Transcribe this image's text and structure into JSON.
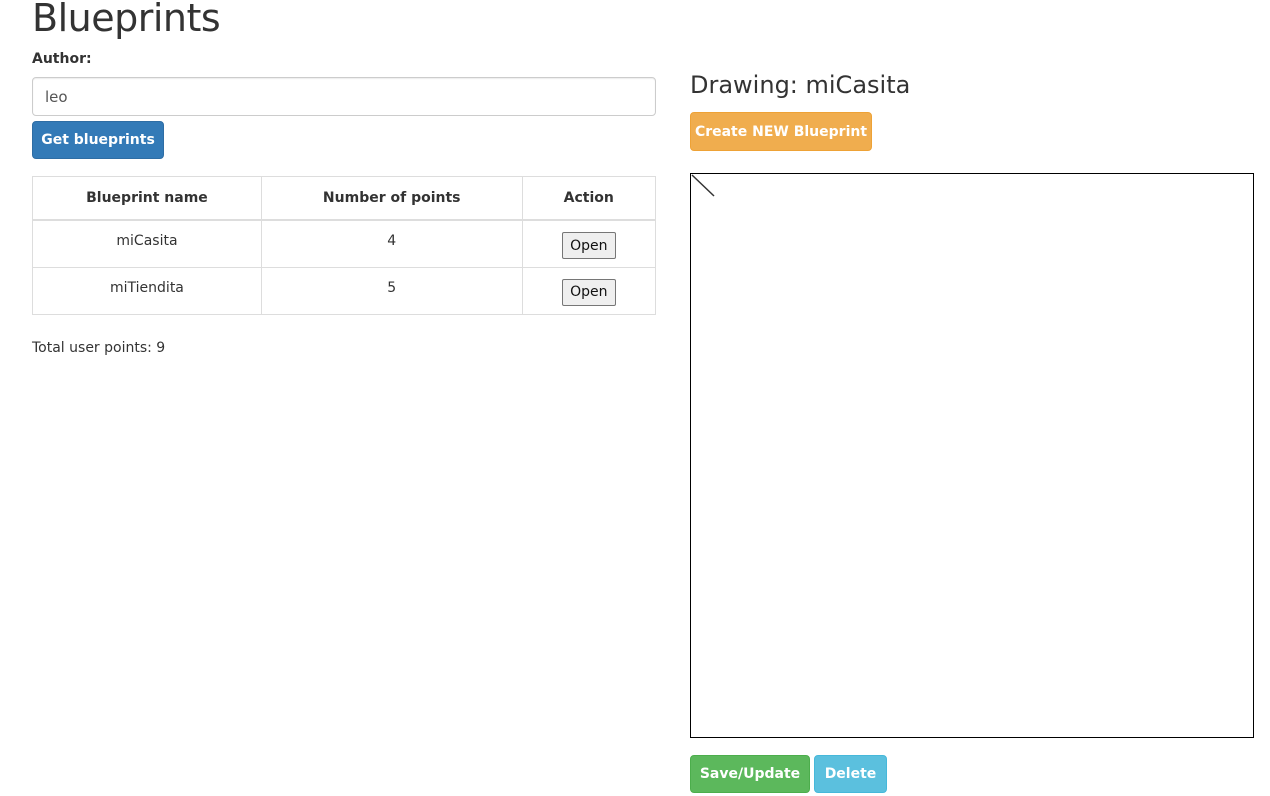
{
  "page": {
    "title": "Blueprints"
  },
  "author": {
    "label": "Author:",
    "value": "leo",
    "placeholder": ""
  },
  "buttons": {
    "get_blueprints": "Get blueprints",
    "create_new": "Create NEW Blueprint",
    "save_update": "Save/Update",
    "delete": "Delete"
  },
  "table": {
    "headers": [
      "Blueprint name",
      "Number of points",
      "Action"
    ],
    "rows": [
      {
        "name": "miCasita",
        "points": "4",
        "action": "Open"
      },
      {
        "name": "miTiendita",
        "points": "5",
        "action": "Open"
      }
    ]
  },
  "total": {
    "text": "Total user points: 9"
  },
  "drawing": {
    "title": "Drawing: miCasita"
  },
  "colors": {
    "primary": "#337ab7",
    "warning": "#f0ad4e",
    "success": "#5cb85c",
    "info": "#5bc0de"
  }
}
